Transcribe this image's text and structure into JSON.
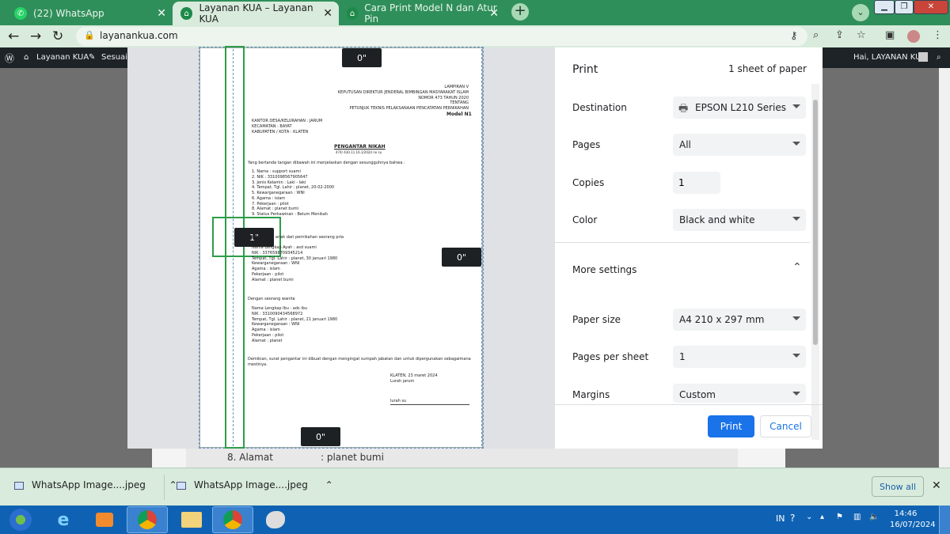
{
  "browser": {
    "tabs": [
      {
        "label": "(22) WhatsApp"
      },
      {
        "label": "Layanan KUA – Layanan KUA"
      },
      {
        "label": "Cara Print Model N dan Atur Pin"
      }
    ],
    "url": "layanankua.com"
  },
  "wp_admin": {
    "site": "Layanan KUA",
    "customize": "Sesuaika",
    "greeting": "Hai, LAYANAN KUA"
  },
  "background_doc": {
    "row_label": "8. Alamat",
    "row_value": ": planet bumi"
  },
  "margin_badges": {
    "top": "0\"",
    "left": "1\"",
    "right": "0\"",
    "bottom": "0\""
  },
  "document": {
    "header_lines": [
      "LAMPIRAN V",
      "KEPUTUSAN DIREKTUR JENDERAL BIMBINGAN MASYARAKAT ISLAM",
      "NOMOR 473 TAHUN 2020",
      "TENTANG",
      "PETUNJUK TEKNIS PELAKSANAAN PENCATATAN PERNIKAHAN"
    ],
    "model": "Model N1",
    "office_lines": [
      "KANTOR DESA/KELURAHAN : JARUM",
      "KECAMATAN            : BAYAT",
      "KABUPATEN / KOTA     : KLATEN"
    ],
    "title": "PENGANTAR NIKAH",
    "number": "474/ 430.11.16.1/2024 no su",
    "intro": "Yang bertanda tangan dibawah ini menjelaskan dengan sesungguhnya bahwa :",
    "person_lines": [
      "1. Nama            : support suami",
      "2. NIK             : 3310098567905647",
      "3. Jenis Kelamin   : Laki - laki",
      "4. Tempat, Tgl. Lahir : planet, 20-02-2000",
      "5. Kewarganegaraan : WNI",
      "6. Agama           : islam",
      "7. Pekerjaan       : pilot",
      "8. Alamat          : planet bumi",
      "9. Status Perkawinan : Belum Menikah"
    ],
    "child_of": "Adalah benar anak dari pernikahan seorang pria",
    "father_lines": [
      "Nama Lengkap Ayah : asd suami",
      "NIK               : 3376598709345214",
      "Tempat, Tgl. Lahir : planet, 30 januari 1980",
      "Kewarganegaraan   : WNI",
      "Agama             : islam",
      "Pekerjaan         : pilot",
      "Alamat            : planet bumi"
    ],
    "with_woman": "Dengan seorang wanita",
    "mother_lines": [
      "Nama Lengkap Ibu : ads ibu",
      "NIK              : 3310090434568972",
      "Tempat, Tgl. Lahir : planet, 21 januari 1980",
      "Kewarganegaraan  : WNI",
      "Agama            : islam",
      "Pekerjaan        : pilot",
      "Alamat           : planet"
    ],
    "closing_1": "Demikian, surat pengantar ini dibuat dengan mengingat sumpah jabatan dan untuk dipergunakan sebagaimana",
    "closing_2": "mestinya.",
    "place_date": "KLATEN, 23 maret 2024",
    "signer_title": "Lurah jarum",
    "signer_name": "lurah su"
  },
  "print_panel": {
    "title": "Print",
    "sheets": "1 sheet of paper",
    "destination_label": "Destination",
    "destination_value": "EPSON L210 Series",
    "pages_label": "Pages",
    "pages_value": "All",
    "copies_label": "Copies",
    "copies_value": "1",
    "color_label": "Color",
    "color_value": "Black and white",
    "more_settings": "More settings",
    "paper_size_label": "Paper size",
    "paper_size_value": "A4 210 x 297 mm",
    "pps_label": "Pages per sheet",
    "pps_value": "1",
    "margins_label": "Margins",
    "margins_value": "Custom",
    "print_button": "Print",
    "cancel_button": "Cancel"
  },
  "downloads": {
    "items": [
      "WhatsApp Image....jpeg",
      "WhatsApp Image....jpeg"
    ],
    "show_all": "Show all"
  },
  "taskbar": {
    "lang": "IN",
    "time": "14:46",
    "date": "16/07/2024"
  },
  "colors": {
    "tab_bar": "#2f8f5a",
    "toolbar": "#d8ebdc",
    "accent_blue": "#1a73e8",
    "margin_guide": "#2e9d4a",
    "taskbar": "#0f62b3"
  }
}
